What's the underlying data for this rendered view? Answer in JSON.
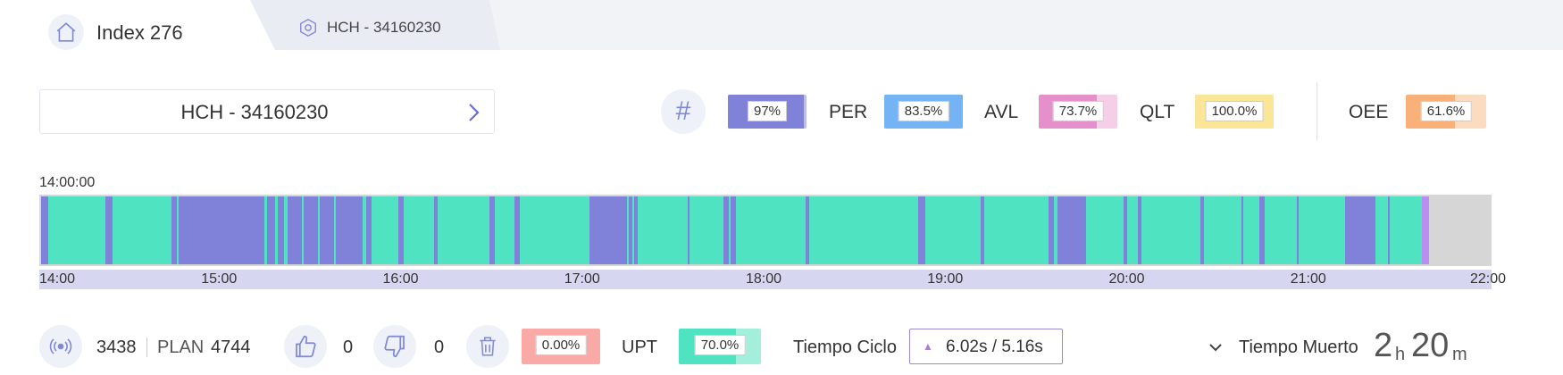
{
  "tabs": {
    "home_title": "Index 276",
    "machine_tab_label": "HCH - 34160230"
  },
  "selector": {
    "label": "HCH - 34160230"
  },
  "kpis": [
    {
      "key": "count",
      "label": "",
      "value": "97%",
      "fill_pct": 97,
      "color": "#8081d8",
      "light": "#bcbde8"
    },
    {
      "key": "per",
      "label": "PER",
      "value": "83.5%",
      "fill_pct": 100,
      "color": "#74b3f4",
      "light": "#74b3f4"
    },
    {
      "key": "avl",
      "label": "AVL",
      "value": "73.7%",
      "fill_pct": 73.7,
      "color": "#e58fcb",
      "light": "#f4cfe7"
    },
    {
      "key": "qlt",
      "label": "QLT",
      "value": "100.0%",
      "fill_pct": 100,
      "color": "#fbe596",
      "light": "#fbe596"
    },
    {
      "key": "oee",
      "label": "OEE",
      "value": "61.6%",
      "fill_pct": 61.6,
      "color": "#f9b179",
      "light": "#fcdcc0"
    }
  ],
  "timeline": {
    "start_time": "14:00:00",
    "ticks": [
      "14:00",
      "15:00",
      "16:00",
      "17:00",
      "18:00",
      "19:00",
      "20:00",
      "21:00",
      "22:00"
    ],
    "colors": {
      "run": "#4fe3c1",
      "stop": "#8081d8",
      "other": "#b98ef0",
      "empty": "#d6d6d6"
    }
  },
  "bottom": {
    "produced": "3438",
    "plan_label": "PLAN",
    "plan_value": "4744",
    "good_count": "0",
    "bad_count": "0",
    "scrap_pct": "0.00%",
    "upt_label": "UPT",
    "upt_value": "70.0%",
    "upt_fill_pct": 70,
    "ciclo_label": "Tiempo Ciclo",
    "ciclo_value": "6.02s  /  5.16s",
    "tm_label": "Tiempo Muerto",
    "tm_hours": "2",
    "tm_hours_unit": "h",
    "tm_minutes": "20",
    "tm_minutes_unit": "m"
  },
  "colors": {
    "scrap": "#f9aaa6",
    "upt": "#4fe3c1",
    "upt_light": "#a4efdc",
    "icon": "#8088d8"
  }
}
